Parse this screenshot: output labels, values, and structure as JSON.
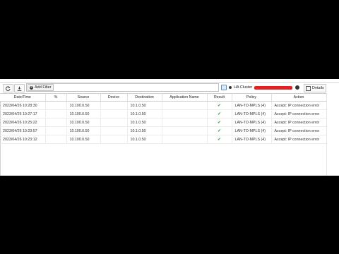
{
  "toolbar": {
    "refresh_icon": "refresh-icon",
    "download_icon": "download-icon",
    "add_filter_label": "Add Filter",
    "ha_cluster_label": "HA Cluster",
    "details_label": "Details"
  },
  "table": {
    "columns": [
      "Date/Time",
      "%",
      "Source",
      "Device",
      "Destination",
      "Application Name",
      "Result",
      "Policy",
      "Action"
    ],
    "rows": [
      {
        "datetime": "2023/04/26 10:28:30",
        "source": "10.100.0.50",
        "device": "",
        "destination": "10.1.0.50",
        "app": "",
        "result": "✔",
        "policy": "LAN-TO-MPLS (4)",
        "action": "Accept: IP connection error"
      },
      {
        "datetime": "2023/04/26 10:27:17",
        "source": "10.100.0.50",
        "device": "",
        "destination": "10.1.0.50",
        "app": "",
        "result": "✔",
        "policy": "LAN-TO-MPLS (4)",
        "action": "Accept: IP connection error"
      },
      {
        "datetime": "2023/04/26 10:25:22",
        "source": "10.100.0.50",
        "device": "",
        "destination": "10.1.0.50",
        "app": "",
        "result": "✔",
        "policy": "LAN-TO-MPLS (4)",
        "action": "Accept: IP connection error"
      },
      {
        "datetime": "2023/04/26 10:23:57",
        "source": "10.100.0.50",
        "device": "",
        "destination": "10.1.0.50",
        "app": "",
        "result": "✔",
        "policy": "LAN-TO-MPLS (4)",
        "action": "Accept: IP connection error"
      },
      {
        "datetime": "2023/04/26 10:23:12",
        "source": "10.100.0.50",
        "device": "",
        "destination": "10.1.0.50",
        "app": "",
        "result": "✔",
        "policy": "LAN-TO-MPLS (4)",
        "action": "Accept: IP connection error"
      }
    ]
  },
  "colors": {
    "background": "#000000",
    "panel": "#ffffff",
    "accept_check": "#2e9b3a",
    "redaction": "#e52020"
  }
}
